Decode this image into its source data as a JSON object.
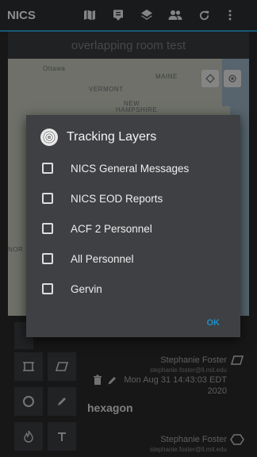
{
  "app": {
    "title": "NICS",
    "room_title": "overlapping room test"
  },
  "toolbar": {
    "icons": [
      "map-icon",
      "messages-icon",
      "layers-icon",
      "people-icon",
      "refresh-icon",
      "overflow-menu-icon"
    ]
  },
  "map": {
    "labels": [
      "Ottawa",
      "MAINE",
      "VERMONT",
      "NEW",
      "HAMPSHIRE",
      "NOR"
    ],
    "controls": [
      "diamond-icon",
      "location-target-icon"
    ]
  },
  "dialog": {
    "title": "Tracking Layers",
    "options": [
      {
        "label": "NICS General Messages",
        "checked": false
      },
      {
        "label": "NICS EOD Reports",
        "checked": false
      },
      {
        "label": "ACF 2 Personnel",
        "checked": false
      },
      {
        "label": "All Personnel",
        "checked": false
      },
      {
        "label": "Gervin",
        "checked": false
      }
    ],
    "ok_label": "OK"
  },
  "feed": {
    "entries": [
      {
        "name": "Stephanie Foster",
        "email": "stephanie.foster@ll.mit.edu",
        "date": "Mon Aug 31 14:43:03 EDT",
        "year": "2020"
      },
      {
        "title": "hexagon",
        "name": "Stephanie Foster",
        "email": "stephanie.foster@ll.mit.edu"
      }
    ]
  },
  "tools": [
    "square-icon",
    "parallelogram-icon",
    "circle-icon",
    "pencil-icon",
    "fire-icon",
    "text-icon"
  ],
  "colors": {
    "accent": "#2aa3d6",
    "ok_button": "#1f8fc8",
    "dialog_bg": "#3e4043"
  }
}
